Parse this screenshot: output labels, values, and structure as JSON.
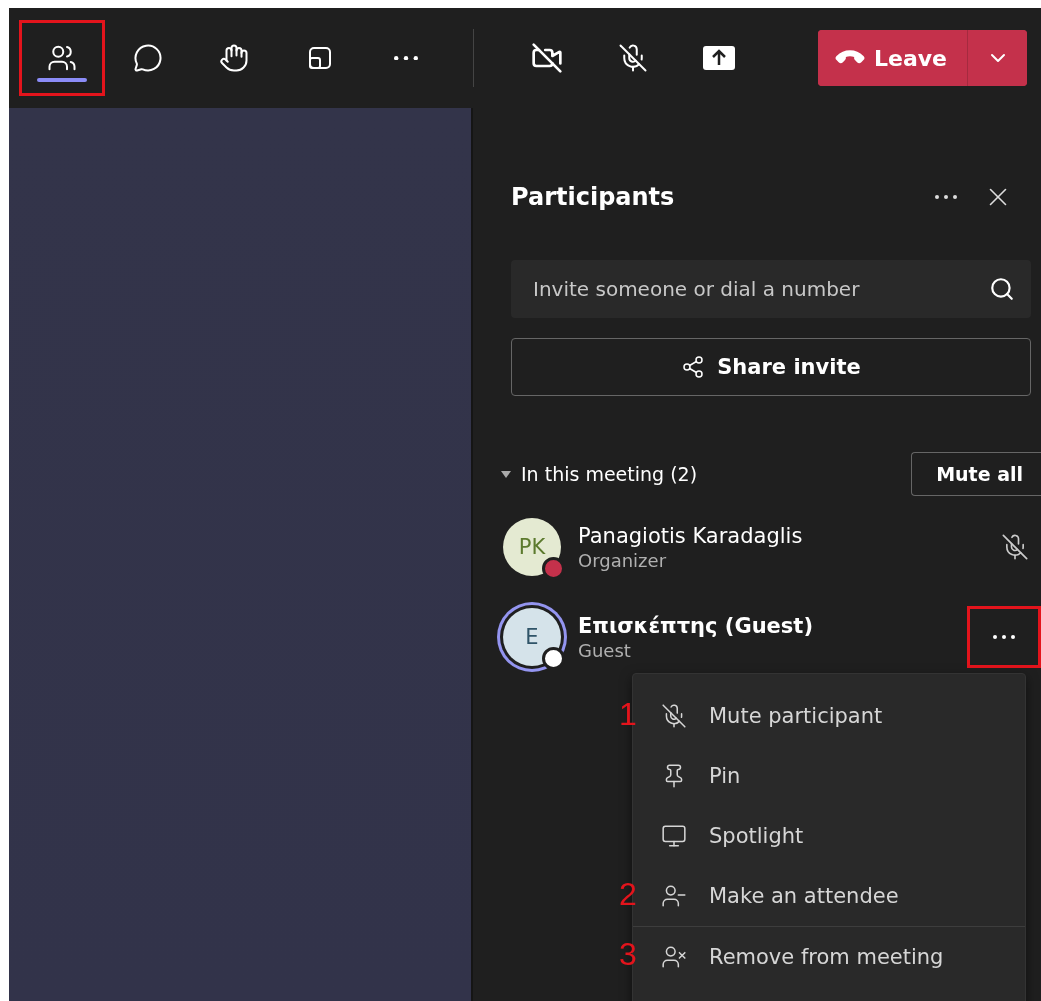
{
  "toolbar": {
    "left_buttons": [
      {
        "kind": "people",
        "selected": true,
        "highlighted": true
      },
      {
        "kind": "chat",
        "selected": false,
        "highlighted": false
      },
      {
        "kind": "react",
        "selected": false,
        "highlighted": false
      },
      {
        "kind": "view",
        "selected": false,
        "highlighted": false
      },
      {
        "kind": "more",
        "selected": false,
        "highlighted": false
      }
    ],
    "right_buttons": [
      {
        "kind": "camera-off"
      },
      {
        "kind": "mic-off"
      },
      {
        "kind": "share"
      }
    ],
    "leave": {
      "label": "Leave"
    }
  },
  "panel": {
    "title": "Participants",
    "search": {
      "placeholder": "Invite someone or dial a number"
    },
    "share_button": "Share invite",
    "section": {
      "label": "In this meeting (2)",
      "expanded": true,
      "action": "Mute all"
    },
    "participants": [
      {
        "initials": "PK",
        "name": "Panagiotis Karadaglis",
        "role": "Organizer",
        "color": "#c4314b",
        "selected": false,
        "muted": true,
        "highlighted": false
      },
      {
        "initials": "E",
        "name": "Επισκέπτης (Guest)",
        "role": "Guest",
        "color": "#ffffff",
        "selected": true,
        "muted": false,
        "highlighted": true
      }
    ],
    "menu": [
      {
        "kind": "mute",
        "label": "Mute participant",
        "marker": "1",
        "divider": false
      },
      {
        "kind": "pin",
        "label": "Pin",
        "divider": false
      },
      {
        "kind": "spotlight",
        "label": "Spotlight",
        "divider": false
      },
      {
        "kind": "attendee",
        "label": "Make an attendee",
        "marker": "2",
        "divider": false
      },
      {
        "kind": "remove",
        "label": "Remove from meeting",
        "marker": "3",
        "divider": true
      }
    ]
  }
}
